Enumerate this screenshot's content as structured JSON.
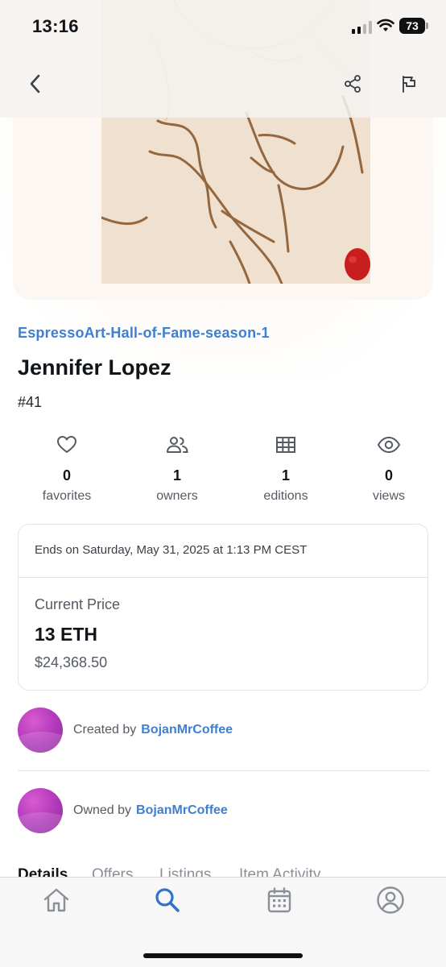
{
  "status_bar": {
    "time": "13:16",
    "battery": "73"
  },
  "nft": {
    "collection": "EspressoArt-Hall-of-Fame-season-1",
    "title": "Jennifer Lopez",
    "token_id": "#41"
  },
  "stats": [
    {
      "icon": "heart-icon",
      "value": "0",
      "label": "favorites"
    },
    {
      "icon": "people-icon",
      "value": "1",
      "label": "owners"
    },
    {
      "icon": "grid-icon",
      "value": "1",
      "label": "editions"
    },
    {
      "icon": "eye-icon",
      "value": "0",
      "label": "views"
    }
  ],
  "sale": {
    "ends": "Ends on Saturday, May 31, 2025 at 1:13 PM CEST",
    "price_label": "Current Price",
    "price": "13 ETH",
    "fiat": "$24,368.50"
  },
  "creator": {
    "prefix": "Created by",
    "name": "BojanMrCoffee"
  },
  "owner": {
    "prefix": "Owned by",
    "name": "BojanMrCoffee"
  },
  "tabs": [
    "Details",
    "Offers",
    "Listings",
    "Item Activity"
  ],
  "nav": [
    "home-icon",
    "search-icon",
    "calendar-icon",
    "profile-icon"
  ],
  "colors": {
    "link": "#3f7fd0",
    "active_nav": "#2f74c8",
    "inactive_nav": "#8a9098"
  }
}
